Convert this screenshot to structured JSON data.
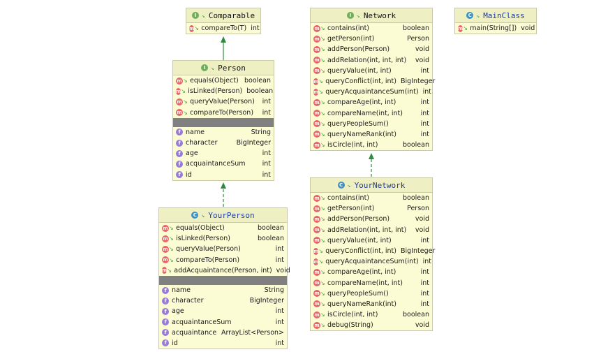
{
  "classes": {
    "comparable": {
      "name": "Comparable",
      "kind": "interface",
      "methods": [
        {
          "name": "compareTo(T)",
          "type": "int"
        }
      ]
    },
    "network": {
      "name": "Network",
      "kind": "interface",
      "methods": [
        {
          "name": "contains(int)",
          "type": "boolean"
        },
        {
          "name": "getPerson(int)",
          "type": "Person"
        },
        {
          "name": "addPerson(Person)",
          "type": "void"
        },
        {
          "name": "addRelation(int, int, int)",
          "type": "void"
        },
        {
          "name": "queryValue(int, int)",
          "type": "int"
        },
        {
          "name": "queryConflict(int, int)",
          "type": "BigInteger"
        },
        {
          "name": "queryAcquaintanceSum(int)",
          "type": "int"
        },
        {
          "name": "compareAge(int, int)",
          "type": "int"
        },
        {
          "name": "compareName(int, int)",
          "type": "int"
        },
        {
          "name": "queryPeopleSum()",
          "type": "int"
        },
        {
          "name": "queryNameRank(int)",
          "type": "int"
        },
        {
          "name": "isCircle(int, int)",
          "type": "boolean"
        }
      ]
    },
    "mainclass": {
      "name": "MainClass",
      "kind": "class",
      "methods": [
        {
          "name": "main(String[])",
          "type": "void"
        }
      ]
    },
    "person": {
      "name": "Person",
      "kind": "interface",
      "methods": [
        {
          "name": "equals(Object)",
          "type": "boolean"
        },
        {
          "name": "isLinked(Person)",
          "type": "boolean"
        },
        {
          "name": "queryValue(Person)",
          "type": "int"
        },
        {
          "name": "compareTo(Person)",
          "type": "int"
        }
      ],
      "fields": [
        {
          "name": "name",
          "type": "String"
        },
        {
          "name": "character",
          "type": "BigInteger"
        },
        {
          "name": "age",
          "type": "int"
        },
        {
          "name": "acquaintanceSum",
          "type": "int"
        },
        {
          "name": "id",
          "type": "int"
        }
      ]
    },
    "yournetwork": {
      "name": "YourNetwork",
      "kind": "class",
      "methods": [
        {
          "name": "contains(int)",
          "type": "boolean"
        },
        {
          "name": "getPerson(int)",
          "type": "Person"
        },
        {
          "name": "addPerson(Person)",
          "type": "void"
        },
        {
          "name": "addRelation(int, int, int)",
          "type": "void"
        },
        {
          "name": "queryValue(int, int)",
          "type": "int"
        },
        {
          "name": "queryConflict(int, int)",
          "type": "BigInteger"
        },
        {
          "name": "queryAcquaintanceSum(int)",
          "type": "int"
        },
        {
          "name": "compareAge(int, int)",
          "type": "int"
        },
        {
          "name": "compareName(int, int)",
          "type": "int"
        },
        {
          "name": "queryPeopleSum()",
          "type": "int"
        },
        {
          "name": "queryNameRank(int)",
          "type": "int"
        },
        {
          "name": "isCircle(int, int)",
          "type": "boolean"
        },
        {
          "name": "debug(String)",
          "type": "void"
        }
      ]
    },
    "yourperson": {
      "name": "YourPerson",
      "kind": "class",
      "methods": [
        {
          "name": "equals(Object)",
          "type": "boolean"
        },
        {
          "name": "isLinked(Person)",
          "type": "boolean"
        },
        {
          "name": "queryValue(Person)",
          "type": "int"
        },
        {
          "name": "compareTo(Person)",
          "type": "int"
        },
        {
          "name": "addAcquaintance(Person, int)",
          "type": "void"
        }
      ],
      "fields": [
        {
          "name": "name",
          "type": "String"
        },
        {
          "name": "character",
          "type": "BigInteger"
        },
        {
          "name": "age",
          "type": "int"
        },
        {
          "name": "acquaintanceSum",
          "type": "int"
        },
        {
          "name": "acquaintance",
          "type": "ArrayList<Person>"
        },
        {
          "name": "id",
          "type": "int"
        }
      ]
    }
  },
  "icons": {
    "interface_badge": "I",
    "class_badge": "C",
    "method_badge": "m",
    "field_badge": "f"
  },
  "colors": {
    "box_fill": "#fcfcd4",
    "header_fill": "#efefc4",
    "class_name": "#1f3d99",
    "relation_arrow": "#2e8b3e"
  }
}
